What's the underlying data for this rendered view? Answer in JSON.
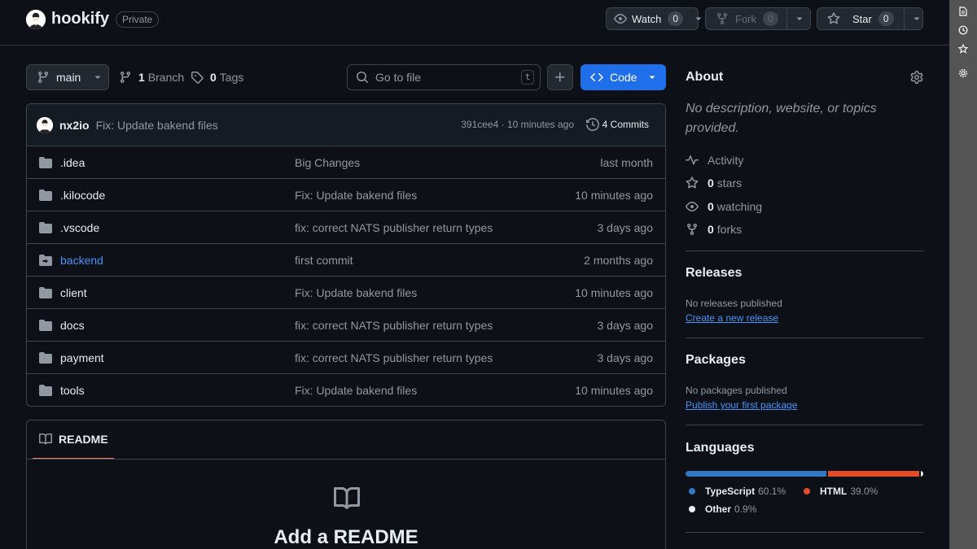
{
  "repo": {
    "name": "hookify",
    "visibility": "Private"
  },
  "actions": {
    "watch": {
      "label": "Watch",
      "count": "0"
    },
    "fork": {
      "label": "Fork",
      "count": "0"
    },
    "star": {
      "label": "Star",
      "count": "0"
    }
  },
  "toolbar": {
    "branch": "main",
    "branch_count": "1",
    "branch_label": "Branch",
    "tag_count": "0",
    "tag_label": "Tags",
    "search_placeholder": "Go to file",
    "search_shortcut": "t",
    "code_label": "Code"
  },
  "latest_commit": {
    "user": "nx2io",
    "message": "Fix: Update bakend files",
    "meta": "391cee4 · 10 minutes ago",
    "commits_label": "4 Commits"
  },
  "files": [
    {
      "name": ".idea",
      "message": "Big Changes",
      "date": "last month",
      "type": "folder"
    },
    {
      "name": ".kilocode",
      "message": "Fix: Update bakend files",
      "date": "10 minutes ago",
      "type": "folder"
    },
    {
      "name": ".vscode",
      "message": "fix: correct NATS publisher return types",
      "date": "3 days ago",
      "type": "folder"
    },
    {
      "name": "backend",
      "message": "first commit",
      "date": "2 months ago",
      "type": "submodule"
    },
    {
      "name": "client",
      "message": "Fix: Update bakend files",
      "date": "10 minutes ago",
      "type": "folder"
    },
    {
      "name": "docs",
      "message": "fix: correct NATS publisher return types",
      "date": "3 days ago",
      "type": "folder"
    },
    {
      "name": "payment",
      "message": "fix: correct NATS publisher return types",
      "date": "3 days ago",
      "type": "folder"
    },
    {
      "name": "tools",
      "message": "Fix: Update bakend files",
      "date": "10 minutes ago",
      "type": "folder"
    }
  ],
  "readme": {
    "tab": "README",
    "title": "Add a README"
  },
  "about": {
    "title": "About",
    "description": "No description, website, or topics provided.",
    "activity": "Activity",
    "stars_count": "0",
    "stars_label": "stars",
    "watching_count": "0",
    "watching_label": "watching",
    "forks_count": "0",
    "forks_label": "forks"
  },
  "releases": {
    "title": "Releases",
    "empty": "No releases published",
    "link": "Create a new release"
  },
  "packages": {
    "title": "Packages",
    "empty": "No packages published",
    "link": "Publish your first package"
  },
  "languages": {
    "title": "Languages",
    "items": [
      {
        "name": "TypeScript",
        "percent": "60.1%",
        "value": 60.1,
        "color": "#3178c6"
      },
      {
        "name": "HTML",
        "percent": "39.0%",
        "value": 39.0,
        "color": "#e34c26"
      },
      {
        "name": "Other",
        "percent": "0.9%",
        "value": 0.9,
        "color": "#ededed"
      }
    ]
  },
  "colors": {
    "accent": "#1f6feb",
    "link": "#4493f8",
    "tab_underline": "#f78166"
  }
}
